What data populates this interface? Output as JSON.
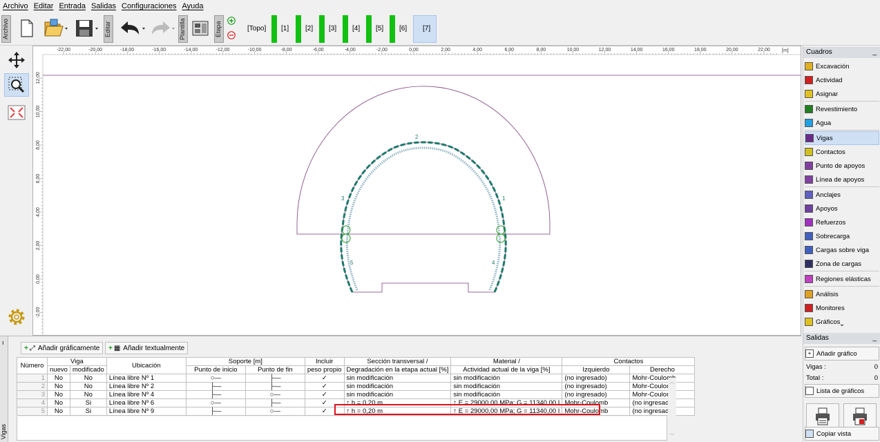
{
  "menu": [
    "Archivo",
    "Editar",
    "Entrada",
    "Salidas",
    "Configuraciones",
    "Ayuda"
  ],
  "toolbar": {
    "archivo_label": "Archivo",
    "editar_label": "Editar",
    "plantilla_label": "Plantilla",
    "etapa_label": "Etapa",
    "stages": [
      "[Topo]",
      "[1]",
      "[2]",
      "[3]",
      "[4]",
      "[5]",
      "[6]",
      "[7]"
    ],
    "active_stage": "[7]"
  },
  "ruler": {
    "top_ticks": [
      "-22,00",
      "-20,00",
      "-18,00",
      "-16,00",
      "-14,00",
      "-12,00",
      "-10,00",
      "-8,00",
      "-6,00",
      "-4,00",
      "-2,00",
      "0,00",
      "2,00",
      "4,00",
      "6,00",
      "8,00",
      "10,00",
      "12,00",
      "14,00",
      "16,00",
      "18,00",
      "20,00",
      "22,00"
    ],
    "unit": "[m]",
    "left_ticks": [
      "12,00",
      "10,00",
      "8,00",
      "6,00",
      "4,00",
      "2,00",
      "0,00",
      "-2,00"
    ]
  },
  "canvas": {
    "beam_labels": [
      "1",
      "2",
      "3",
      "4",
      "5"
    ]
  },
  "cuadros": {
    "title": "Cuadros",
    "items": [
      {
        "label": "Excavación",
        "icon": "excavation-icon",
        "color": "#e0b020"
      },
      {
        "label": "Actividad",
        "icon": "activity-icon",
        "color": "#d02020"
      },
      {
        "label": "Asignar",
        "icon": "assign-icon",
        "color": "#e0c020"
      },
      {
        "label": "Revestimiento",
        "icon": "lining-icon",
        "color": "#208020"
      },
      {
        "label": "Agua",
        "icon": "water-icon",
        "color": "#20a0e0"
      },
      {
        "label": "Vigas",
        "icon": "beams-icon",
        "color": "#6a2a8a"
      },
      {
        "label": "Contactos",
        "icon": "contacts-icon",
        "color": "#d0c020"
      },
      {
        "label": "Punto de apoyos",
        "icon": "support-point-icon",
        "color": "#8040a0"
      },
      {
        "label": "Línea de apoyos",
        "icon": "support-line-icon",
        "color": "#8040a0"
      },
      {
        "label": "Anclajes",
        "icon": "anchors-icon",
        "color": "#6060c0"
      },
      {
        "label": "Apoyos",
        "icon": "props-icon",
        "color": "#7040a0"
      },
      {
        "label": "Refuerzos",
        "icon": "reinforcement-icon",
        "color": "#a030c0"
      },
      {
        "label": "Sobrecarga",
        "icon": "surcharge-icon",
        "color": "#4060c0"
      },
      {
        "label": "Cargas sobre viga",
        "icon": "beam-loads-icon",
        "color": "#4060c0"
      },
      {
        "label": "Zona de cargas",
        "icon": "load-zone-icon",
        "color": "#303060"
      },
      {
        "label": "Regiones elásticas",
        "icon": "elastic-regions-icon",
        "color": "#c040c0"
      },
      {
        "label": "Análisis",
        "icon": "analysis-icon",
        "color": "#e0a020"
      },
      {
        "label": "Monitores",
        "icon": "monitors-icon",
        "color": "#d02020"
      },
      {
        "label": "Gráficos",
        "icon": "graphs-icon",
        "color": "#e0c020"
      }
    ],
    "selected": "Vigas"
  },
  "salidas": {
    "title": "Salidas",
    "add_graph": "Añadir gráfico",
    "vigas_label": "Vigas :",
    "vigas_count": "0",
    "total_label": "Total :",
    "total_count": "0",
    "graph_list": "Lista de gráficos",
    "copy_view": "Copiar vista"
  },
  "bottom": {
    "tab_label": "Vigas",
    "add_graphic": "Añadir gráficamente",
    "add_text": "Añadir textualmente",
    "headers": {
      "numero": "Número",
      "viga": "Viga",
      "nuevo": "nuevo",
      "modificado": "modificado",
      "ubicacion": "Ubicación",
      "soporte": "Soporte [m]",
      "punto_inicio": "Punto de inicio",
      "punto_fin": "Punto de fin",
      "incluir": "Incluir",
      "peso_propio": "peso propio",
      "seccion": "Sección transversal /",
      "degradacion": "Degradación en la etapa actual [%]",
      "material": "Material /",
      "actividad": "Actividad actual de la viga [%]",
      "contactos": "Contactos",
      "izquierdo": "Izquierdo",
      "derecho": "Derecho"
    },
    "rows": [
      {
        "num": "1",
        "nuevo": "No",
        "mod": "No",
        "ubic": "Línea libre Nº 1",
        "ini": "○—",
        "fin": "├—",
        "peso": "✓",
        "sec": "sin modificación",
        "mat": "sin modificación",
        "izq": "(no ingresado)",
        "der": "Mohr-Coulomb"
      },
      {
        "num": "2",
        "nuevo": "No",
        "mod": "No",
        "ubic": "Línea libre Nº 2",
        "ini": "├—",
        "fin": "├—",
        "peso": "✓",
        "sec": "sin modificación",
        "mat": "sin modificación",
        "izq": "(no ingresado)",
        "der": "Mohr-Coulomb"
      },
      {
        "num": "3",
        "nuevo": "No",
        "mod": "No",
        "ubic": "Línea libre Nº 4",
        "ini": "├—",
        "fin": "○—",
        "peso": "✓",
        "sec": "sin modificación",
        "mat": "sin modificación",
        "izq": "(no ingresado)",
        "der": "Mohr-Coulomb"
      },
      {
        "num": "4",
        "nuevo": "No",
        "mod": "Si",
        "ubic": "Línea libre Nº 6",
        "ini": "○—",
        "fin": "├—",
        "peso": "✓",
        "sec": "↑ h = 0,20 m",
        "mat": "↑ E = 29000,00 MPa; G = 11340,00 I",
        "izq": "Mohr-Coulomb",
        "der": "(no ingresado)"
      },
      {
        "num": "5",
        "nuevo": "No",
        "mod": "Si",
        "ubic": "Línea libre Nº 9",
        "ini": "├—",
        "fin": "○—",
        "peso": "✓",
        "sec": "↑ h = 0,20 m",
        "mat": "↑ E = 29000,00 MPa; G = 11340,00 I",
        "izq": "Mohr-Coulomb",
        "der": "(no ingresado)"
      }
    ]
  }
}
